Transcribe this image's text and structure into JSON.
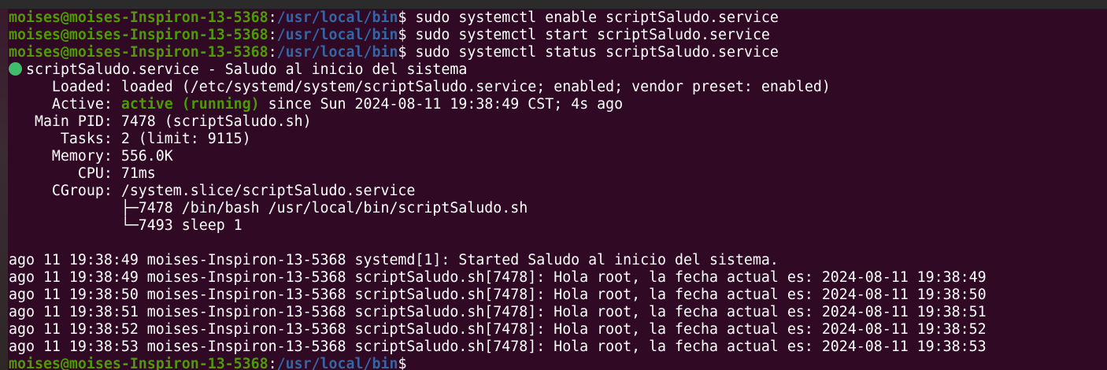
{
  "terminal": {
    "prompt_user": "moises@moises-Inspiron-13-5368",
    "prompt_sep": ":",
    "prompt_path": "/usr/local/bin",
    "prompt_end": "$ ",
    "commands": [
      "sudo systemctl enable scriptSaludo.service",
      "sudo systemctl start scriptSaludo.service",
      "sudo systemctl status scriptSaludo.service"
    ],
    "status": {
      "unit_line": "scriptSaludo.service - Saludo al inicio del sistema",
      "loaded": "     Loaded: loaded (/etc/systemd/system/scriptSaludo.service; enabled; vendor preset: enabled)",
      "active_label": "     Active: ",
      "active_state": "active (running)",
      "active_rest": " since Sun 2024-08-11 19:38:49 CST; 4s ago",
      "main_pid": "   Main PID: 7478 (scriptSaludo.sh)",
      "tasks": "      Tasks: 2 (limit: 9115)",
      "memory": "     Memory: 556.0K",
      "cpu": "        CPU: 71ms",
      "cgroup": "     CGroup: /system.slice/scriptSaludo.service",
      "cgroup_child_1": "             ├─7478 /bin/bash /usr/local/bin/scriptSaludo.sh",
      "cgroup_child_2": "             └─7493 sleep 1"
    },
    "log_lines": [
      "ago 11 19:38:49 moises-Inspiron-13-5368 systemd[1]: Started Saludo al inicio del sistema.",
      "ago 11 19:38:49 moises-Inspiron-13-5368 scriptSaludo.sh[7478]: Hola root, la fecha actual es: 2024-08-11 19:38:49",
      "ago 11 19:38:50 moises-Inspiron-13-5368 scriptSaludo.sh[7478]: Hola root, la fecha actual es: 2024-08-11 19:38:50",
      "ago 11 19:38:51 moises-Inspiron-13-5368 scriptSaludo.sh[7478]: Hola root, la fecha actual es: 2024-08-11 19:38:51",
      "ago 11 19:38:52 moises-Inspiron-13-5368 scriptSaludo.sh[7478]: Hola root, la fecha actual es: 2024-08-11 19:38:52",
      "ago 11 19:38:53 moises-Inspiron-13-5368 scriptSaludo.sh[7478]: Hola root, la fecha actual es: 2024-08-11 19:38:53"
    ],
    "colors": {
      "background": "#300a24",
      "prompt_user": "#4e9a06",
      "prompt_path": "#3465a4",
      "active_dot": "#3fbd6a",
      "text": "#ffffff"
    }
  }
}
